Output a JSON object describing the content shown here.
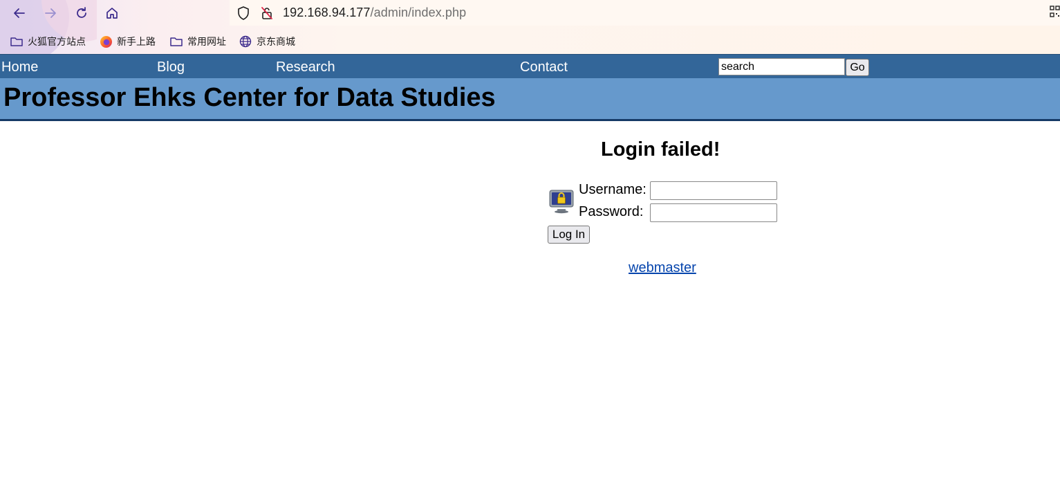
{
  "browser": {
    "url_host": "192.168.94.177",
    "url_path": "/admin/index.php",
    "bookmarks": [
      {
        "label": "火狐官方站点",
        "icon": "folder-icon"
      },
      {
        "label": "新手上路",
        "icon": "firefox-icon"
      },
      {
        "label": "常用网址",
        "icon": "folder-icon"
      },
      {
        "label": "京东商城",
        "icon": "globe-icon"
      }
    ]
  },
  "nav": {
    "links": [
      "Home",
      "Blog",
      "Research",
      "Contact"
    ],
    "search_value": "search",
    "go_label": "Go"
  },
  "banner": {
    "title": "Professor Ehks Center for Data Studies"
  },
  "login": {
    "heading": "Login failed!",
    "username_label": "Username:",
    "password_label": "Password:",
    "username_value": "",
    "password_value": "",
    "submit_label": "Log In",
    "webmaster_label": "webmaster"
  },
  "colors": {
    "nav_bg": "#336699",
    "banner_bg": "#6699cc",
    "banner_border": "#163a66",
    "link": "#0645ad"
  }
}
